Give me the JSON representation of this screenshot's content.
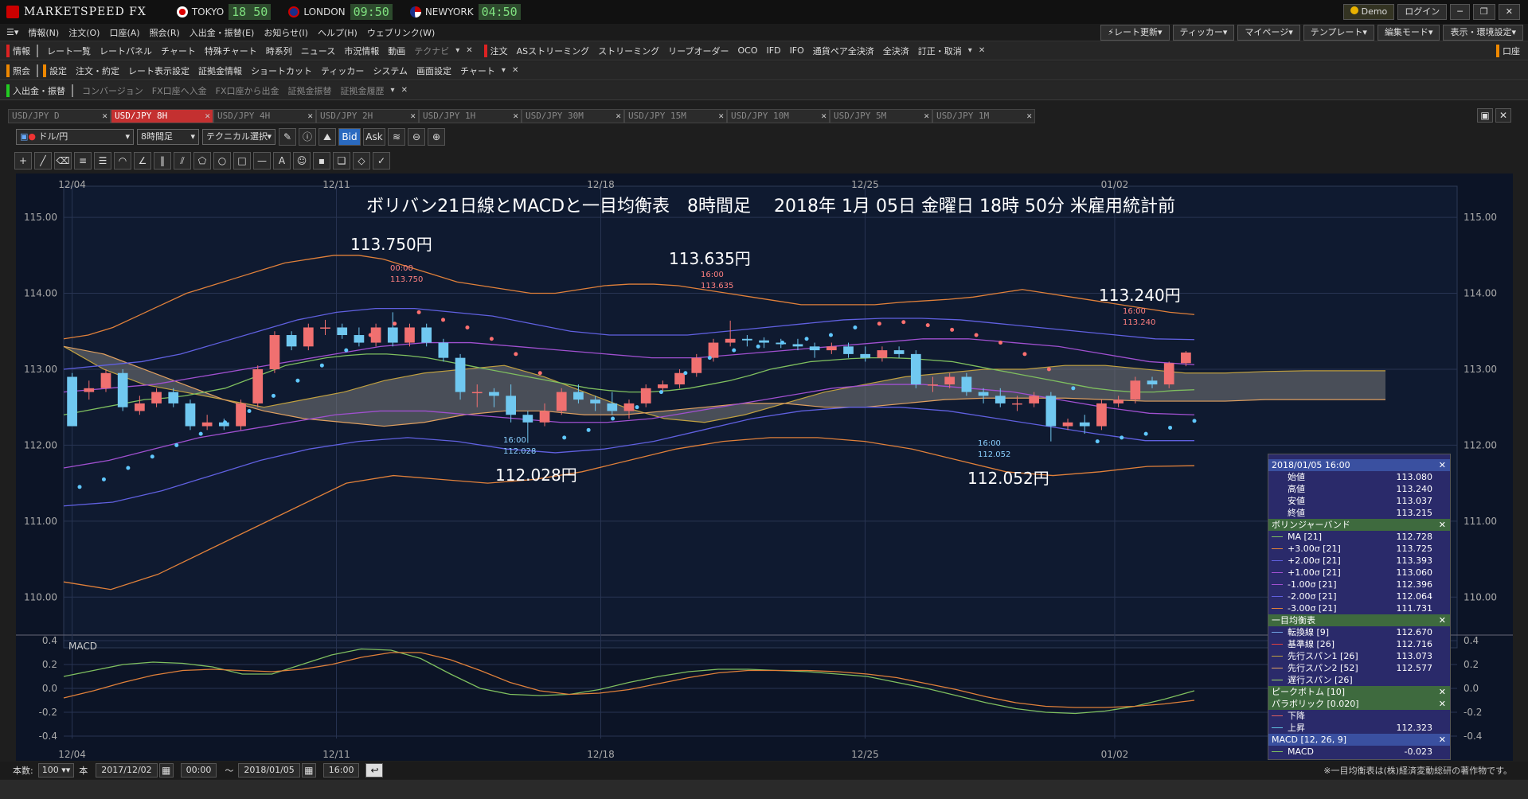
{
  "titlebar": {
    "app": "MARKETSPEED FX",
    "cities": [
      {
        "name": "TOKYO",
        "time": "18 50"
      },
      {
        "name": "LONDON",
        "time": "09:50"
      },
      {
        "name": "NEWYORK",
        "time": "04:50"
      }
    ],
    "demo": "Demo",
    "login": "ログイン"
  },
  "menu": [
    "情報(N)",
    "注文(O)",
    "口座(A)",
    "照会(R)",
    "入出金・振替(E)",
    "お知らせ(I)",
    "ヘルプ(H)",
    "ウェブリンク(W)"
  ],
  "menu_right": [
    "レート更新",
    "ティッカー",
    "マイページ",
    "テンプレート",
    "編集モード",
    "表示・環境設定"
  ],
  "tb1": {
    "left_label": "情報",
    "items": [
      "レート一覧",
      "レートパネル",
      "チャート",
      "特殊チャート",
      "時系列",
      "ニュース",
      "市況情報",
      "動画",
      "テクナビ"
    ],
    "order_label": "注文",
    "order_items": [
      "ASストリーミング",
      "ストリーミング",
      "リーブオーダー",
      "OCO",
      "IFD",
      "IFO",
      "通貨ペア全決済",
      "全決済",
      "訂正・取消"
    ],
    "right": "口座"
  },
  "tb2": {
    "left_label": "照会",
    "settings_label": "設定",
    "items": [
      "注文・約定",
      "レート表示設定",
      "証拠金情報",
      "ショートカット",
      "ティッカー",
      "システム",
      "画面設定",
      "チャート"
    ]
  },
  "tb3": {
    "left_label": "入出金・振替",
    "items": [
      "コンバージョン",
      "FX口座へ入金",
      "FX口座から出金",
      "証拠金振替",
      "証拠金履歴"
    ]
  },
  "tabs": [
    "USD/JPY D",
    "USD/JPY 8H",
    "USD/JPY 4H",
    "USD/JPY 2H",
    "USD/JPY 1H",
    "USD/JPY 30M",
    "USD/JPY 15M",
    "USD/JPY 10M",
    "USD/JPY 5M",
    "USD/JPY 1M"
  ],
  "charttb": {
    "pair": "ドル/円",
    "timeframe": "8時間足",
    "tech": "テクニカル選択",
    "bid": "Bid",
    "ask": "Ask"
  },
  "chart_title": "ボリバン21日線とMACDと一目均衡表　8時間足　 2018年 1月 05日 金曜日 18時 50分 米雇用統計前",
  "annotations": [
    {
      "text": "113.750円",
      "sub1": "00:00",
      "sub2": "113.750"
    },
    {
      "text": "113.635円",
      "sub1": "16:00",
      "sub2": "113.635"
    },
    {
      "text": "113.240円",
      "sub1": "16:00",
      "sub2": "113.240"
    },
    {
      "text": "112.028円",
      "sub1": "16:00",
      "sub2": "112.028"
    },
    {
      "text": "112.052円",
      "sub1": "16:00",
      "sub2": "112.052"
    }
  ],
  "macd_label": "MACD",
  "chart_data": {
    "type": "line",
    "x_ticks": [
      "12/04",
      "12/11",
      "12/18",
      "12/25",
      "01/02"
    ],
    "price_ticks": [
      "115.00",
      "114.00",
      "113.00",
      "112.00",
      "111.00",
      "110.00"
    ],
    "ylim": [
      109.5,
      115.2
    ],
    "macd_ticks": [
      "0.4",
      "0.2",
      "0.0",
      "-0.2",
      "-0.4"
    ],
    "macd_ylim": [
      -0.42,
      0.42
    ],
    "candles": [
      [
        112.9,
        112.25,
        112.25,
        112.95
      ],
      [
        112.7,
        112.75,
        112.6,
        112.85
      ],
      [
        112.75,
        112.95,
        112.7,
        113.0
      ],
      [
        112.95,
        112.5,
        112.45,
        113.0
      ],
      [
        112.45,
        112.55,
        112.4,
        112.65
      ],
      [
        112.55,
        112.7,
        112.5,
        112.75
      ],
      [
        112.7,
        112.55,
        112.5,
        112.75
      ],
      [
        112.55,
        112.25,
        112.2,
        112.6
      ],
      [
        112.25,
        112.3,
        112.2,
        112.4
      ],
      [
        112.3,
        112.25,
        112.2,
        112.35
      ],
      [
        112.25,
        112.55,
        112.2,
        112.6
      ],
      [
        112.55,
        113.0,
        112.5,
        113.05
      ],
      [
        113.0,
        113.45,
        112.95,
        113.5
      ],
      [
        113.45,
        113.3,
        113.25,
        113.5
      ],
      [
        113.3,
        113.55,
        113.25,
        113.6
      ],
      [
        113.55,
        113.55,
        113.45,
        113.65
      ],
      [
        113.55,
        113.45,
        113.4,
        113.6
      ],
      [
        113.45,
        113.35,
        113.3,
        113.55
      ],
      [
        113.35,
        113.55,
        113.3,
        113.6
      ],
      [
        113.55,
        113.35,
        113.3,
        113.75
      ],
      [
        113.35,
        113.55,
        113.3,
        113.6
      ],
      [
        113.55,
        113.35,
        113.3,
        113.6
      ],
      [
        113.35,
        113.15,
        113.1,
        113.4
      ],
      [
        113.15,
        112.7,
        112.6,
        113.2
      ],
      [
        112.7,
        112.7,
        112.5,
        112.8
      ],
      [
        112.7,
        112.65,
        112.5,
        112.75
      ],
      [
        112.65,
        112.4,
        112.3,
        112.8
      ],
      [
        112.4,
        112.3,
        112.03,
        112.45
      ],
      [
        112.3,
        112.45,
        112.25,
        112.55
      ],
      [
        112.45,
        112.7,
        112.4,
        112.75
      ],
      [
        112.7,
        112.6,
        112.55,
        112.8
      ],
      [
        112.6,
        112.55,
        112.45,
        112.65
      ],
      [
        112.55,
        112.45,
        112.4,
        112.7
      ],
      [
        112.45,
        112.55,
        112.35,
        112.6
      ],
      [
        112.55,
        112.75,
        112.5,
        112.8
      ],
      [
        112.75,
        112.8,
        112.7,
        112.85
      ],
      [
        112.8,
        112.95,
        112.75,
        113.0
      ],
      [
        112.95,
        113.15,
        112.9,
        113.2
      ],
      [
        113.15,
        113.35,
        113.1,
        113.4
      ],
      [
        113.35,
        113.4,
        113.3,
        113.64
      ],
      [
        113.4,
        113.38,
        113.3,
        113.45
      ],
      [
        113.38,
        113.35,
        113.28,
        113.42
      ],
      [
        113.35,
        113.33,
        113.28,
        113.4
      ],
      [
        113.33,
        113.3,
        113.25,
        113.4
      ],
      [
        113.3,
        113.25,
        113.15,
        113.35
      ],
      [
        113.25,
        113.3,
        113.2,
        113.35
      ],
      [
        113.3,
        113.2,
        113.15,
        113.35
      ],
      [
        113.2,
        113.15,
        113.1,
        113.3
      ],
      [
        113.15,
        113.25,
        113.1,
        113.3
      ],
      [
        113.25,
        113.2,
        113.15,
        113.3
      ],
      [
        113.2,
        112.8,
        112.75,
        113.25
      ],
      [
        112.8,
        112.8,
        112.7,
        112.9
      ],
      [
        112.8,
        112.9,
        112.75,
        112.95
      ],
      [
        112.9,
        112.7,
        112.65,
        112.95
      ],
      [
        112.7,
        112.65,
        112.55,
        112.75
      ],
      [
        112.65,
        112.55,
        112.5,
        112.75
      ],
      [
        112.55,
        112.55,
        112.45,
        112.65
      ],
      [
        112.55,
        112.65,
        112.5,
        112.7
      ],
      [
        112.65,
        112.25,
        112.05,
        112.7
      ],
      [
        112.25,
        112.3,
        112.2,
        112.35
      ],
      [
        112.3,
        112.25,
        112.15,
        112.4
      ],
      [
        112.25,
        112.55,
        112.2,
        112.6
      ],
      [
        112.55,
        112.6,
        112.5,
        112.65
      ],
      [
        112.6,
        112.85,
        112.55,
        112.9
      ],
      [
        112.85,
        112.8,
        112.75,
        112.9
      ],
      [
        112.8,
        113.08,
        112.75,
        113.1
      ],
      [
        113.08,
        113.22,
        113.04,
        113.24
      ]
    ],
    "series": [
      {
        "name": "MA [21]",
        "color": "#7fbf5f",
        "values": [
          112.4,
          112.45,
          112.5,
          112.55,
          112.6,
          112.62,
          112.65,
          112.7,
          112.75,
          112.85,
          112.95,
          113.05,
          113.1,
          113.15,
          113.18,
          113.2,
          113.2,
          113.18,
          113.15,
          113.1,
          113.05,
          113.0,
          112.95,
          112.9,
          112.85,
          112.8,
          112.75,
          112.72,
          112.7,
          112.7,
          112.72,
          112.75,
          112.8,
          112.85,
          112.92,
          113.0,
          113.05,
          113.1,
          113.12,
          113.14,
          113.15,
          113.15,
          113.14,
          113.12,
          113.1,
          113.05,
          113.0,
          112.95,
          112.9,
          112.85,
          112.8,
          112.75,
          112.72,
          112.7,
          112.7,
          112.72,
          112.73
        ]
      },
      {
        "name": "+3.00σ [21]",
        "color": "#e0803a",
        "values": [
          113.4,
          113.45,
          113.55,
          113.7,
          113.85,
          114.0,
          114.1,
          114.2,
          114.3,
          114.4,
          114.45,
          114.5,
          114.5,
          114.45,
          114.35,
          114.25,
          114.15,
          114.1,
          114.05,
          114.0,
          114.0,
          114.05,
          114.1,
          114.12,
          114.12,
          114.1,
          114.05,
          114.0,
          113.95,
          113.9,
          113.85,
          113.85,
          113.85,
          113.85,
          113.88,
          113.9,
          113.92,
          113.95,
          114.0,
          114.05,
          114.0,
          113.95,
          113.9,
          113.85,
          113.8,
          113.75,
          113.72
        ]
      },
      {
        "name": "+2.00σ [21]",
        "color": "#6060e0",
        "values": [
          113.0,
          113.05,
          113.1,
          113.2,
          113.35,
          113.5,
          113.65,
          113.75,
          113.8,
          113.8,
          113.75,
          113.7,
          113.6,
          113.5,
          113.45,
          113.45,
          113.45,
          113.5,
          113.55,
          113.6,
          113.65,
          113.67,
          113.67,
          113.65,
          113.6,
          113.55,
          113.5,
          113.45,
          113.4,
          113.39
        ]
      },
      {
        "name": "+1.00σ [21]",
        "color": "#a050d0",
        "values": [
          112.7,
          112.75,
          112.8,
          112.9,
          113.0,
          113.1,
          113.2,
          113.3,
          113.35,
          113.35,
          113.3,
          113.25,
          113.2,
          113.15,
          113.15,
          113.2,
          113.25,
          113.3,
          113.35,
          113.4,
          113.4,
          113.35,
          113.3,
          113.2,
          113.1,
          113.06
        ]
      },
      {
        "name": "-1.00σ [21]",
        "color": "#a050d0",
        "values": [
          111.7,
          111.8,
          111.95,
          112.1,
          112.2,
          112.3,
          112.4,
          112.45,
          112.45,
          112.4,
          112.35,
          112.3,
          112.3,
          112.35,
          112.45,
          112.55,
          112.65,
          112.75,
          112.8,
          112.8,
          112.75,
          112.7,
          112.6,
          112.5,
          112.42,
          112.4
        ]
      },
      {
        "name": "-2.00σ [21]",
        "color": "#6060e0",
        "values": [
          111.2,
          111.25,
          111.4,
          111.6,
          111.8,
          111.95,
          112.05,
          112.1,
          112.05,
          111.95,
          111.9,
          111.95,
          112.05,
          112.2,
          112.35,
          112.45,
          112.5,
          112.5,
          112.45,
          112.35,
          112.25,
          112.15,
          112.06,
          112.06
        ]
      },
      {
        "name": "-3.00σ [21]",
        "color": "#e0803a",
        "values": [
          110.2,
          110.1,
          110.3,
          110.6,
          110.9,
          111.2,
          111.5,
          111.6,
          111.55,
          111.5,
          111.55,
          111.65,
          111.8,
          111.95,
          112.05,
          112.1,
          112.1,
          112.05,
          111.95,
          111.8,
          111.65,
          111.6,
          111.65,
          111.72,
          111.73
        ]
      }
    ],
    "ichimoku": {
      "spanA": [
        113.3,
        113.0,
        112.8,
        112.7,
        112.6,
        112.5,
        112.6,
        112.7,
        112.85,
        112.95,
        113.0,
        113.05,
        112.9,
        112.7,
        112.5,
        112.35,
        112.3,
        112.4,
        112.55,
        112.7,
        112.8,
        112.9,
        112.95,
        113.0,
        113.0,
        113.05,
        113.05,
        113.0,
        112.95,
        112.95,
        112.97,
        112.98,
        112.98,
        112.98
      ],
      "spanB": [
        113.3,
        113.2,
        113.0,
        112.8,
        112.6,
        112.45,
        112.35,
        112.3,
        112.25,
        112.3,
        112.4,
        112.45,
        112.45,
        112.4,
        112.4,
        112.45,
        112.5,
        112.55,
        112.55,
        112.5,
        112.5,
        112.55,
        112.6,
        112.62,
        112.62,
        112.62,
        112.6,
        112.58,
        112.58,
        112.58,
        112.6,
        112.6,
        112.6,
        112.6
      ]
    },
    "parabolic": [
      111.45,
      111.55,
      111.7,
      111.85,
      112.0,
      112.15,
      112.3,
      112.45,
      112.65,
      112.85,
      113.05,
      113.25,
      113.45,
      113.6,
      113.75,
      113.65,
      113.55,
      113.4,
      113.2,
      112.95,
      112.1,
      112.2,
      112.35,
      112.5,
      112.7,
      112.95,
      113.15,
      113.25,
      113.3,
      113.35,
      113.4,
      113.45,
      113.55,
      113.6,
      113.62,
      113.58,
      113.52,
      113.45,
      113.35,
      113.2,
      113.0,
      112.75,
      112.05,
      112.1,
      112.15,
      112.23,
      112.32
    ],
    "macd": {
      "macd": [
        0.1,
        0.15,
        0.2,
        0.22,
        0.21,
        0.18,
        0.12,
        0.12,
        0.2,
        0.28,
        0.33,
        0.32,
        0.25,
        0.12,
        0.0,
        -0.05,
        -0.06,
        -0.05,
        -0.01,
        0.05,
        0.1,
        0.14,
        0.16,
        0.16,
        0.15,
        0.14,
        0.12,
        0.1,
        0.05,
        0.0,
        -0.06,
        -0.12,
        -0.17,
        -0.2,
        -0.21,
        -0.19,
        -0.15,
        -0.09,
        -0.02
      ],
      "signal": [
        -0.08,
        -0.02,
        0.05,
        0.11,
        0.15,
        0.16,
        0.15,
        0.14,
        0.16,
        0.2,
        0.26,
        0.3,
        0.3,
        0.24,
        0.15,
        0.05,
        -0.02,
        -0.05,
        -0.04,
        -0.01,
        0.04,
        0.09,
        0.13,
        0.15,
        0.15,
        0.15,
        0.14,
        0.12,
        0.09,
        0.04,
        -0.01,
        -0.07,
        -0.12,
        -0.15,
        -0.16,
        -0.16,
        -0.15,
        -0.13,
        -0.1
      ]
    }
  },
  "infopanel": {
    "header": "2018/01/05 16:00",
    "ohlc": [
      [
        "始値",
        "113.080"
      ],
      [
        "高値",
        "113.240"
      ],
      [
        "安値",
        "113.037"
      ],
      [
        "終値",
        "113.215"
      ]
    ],
    "boll_title": "ボリンジャーバンド",
    "boll": [
      [
        "MA [21]",
        "112.728",
        "#7fbf5f"
      ],
      [
        "+3.00σ [21]",
        "113.725",
        "#e0803a"
      ],
      [
        "+2.00σ [21]",
        "113.393",
        "#6060e0"
      ],
      [
        "+1.00σ [21]",
        "113.060",
        "#a050d0"
      ],
      [
        "-1.00σ [21]",
        "112.396",
        "#a050d0"
      ],
      [
        "-2.00σ [21]",
        "112.064",
        "#6060e0"
      ],
      [
        "-3.00σ [21]",
        "111.731",
        "#e0803a"
      ]
    ],
    "ichi_title": "一目均衡表",
    "ichi": [
      [
        "転換線 [9]",
        "112.670",
        "#6fa0e0"
      ],
      [
        "基準線 [26]",
        "112.716",
        "#e04040"
      ],
      [
        "先行スパン1 [26]",
        "113.073",
        "#c0a040"
      ],
      [
        "先行スパン2 [52]",
        "112.577",
        "#e0a060"
      ],
      [
        "遅行スパン [26]",
        "",
        "#a0e060"
      ]
    ],
    "peak_title": "ピークボトム [10]",
    "para_title": "パラボリック [0.020]",
    "para": [
      [
        "下降",
        "",
        "#e06060"
      ],
      [
        "上昇",
        "112.323",
        "#60c0e0"
      ]
    ],
    "macd_title": "MACD [12, 26, 9]",
    "macd": [
      [
        "MACD",
        "-0.023",
        "#7fbf5f"
      ]
    ]
  },
  "bottom": {
    "count_label": "本数:",
    "count": "100",
    "unit": "本",
    "from_date": "2017/12/02",
    "from_time": "00:00",
    "to_date": "2018/01/05",
    "to_time": "16:00",
    "tilde": "～",
    "copyright": "※一目均衡表は(株)経済変動総研の著作物です。"
  }
}
